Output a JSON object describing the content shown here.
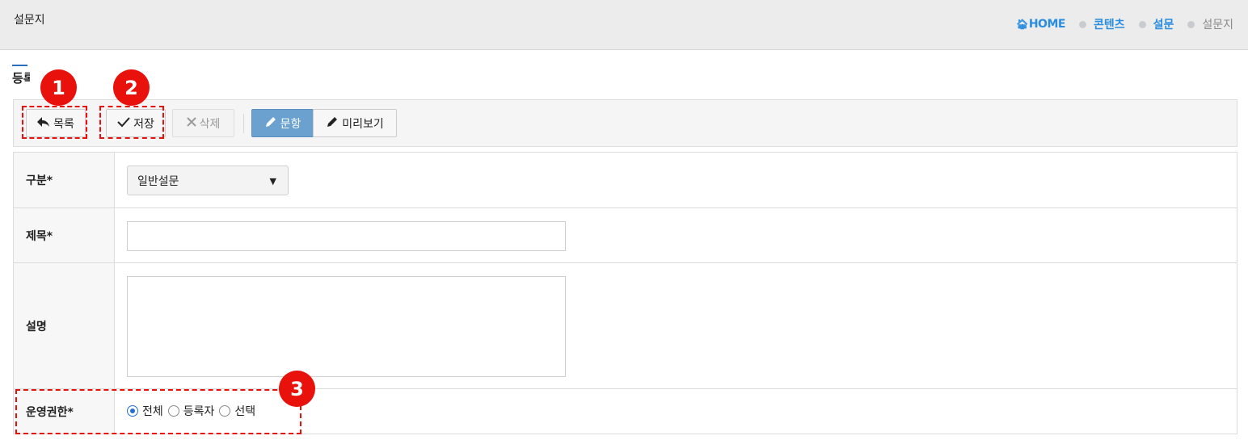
{
  "header": {
    "title": "설문지",
    "breadcrumb": {
      "home_icon": "home-icon",
      "home": "HOME",
      "items": [
        "콘텐츠",
        "설문",
        "설문지"
      ]
    }
  },
  "section": {
    "title": "등록"
  },
  "toolbar": {
    "list_label": "목록",
    "save_label": "저장",
    "delete_label": "삭제",
    "question_label": "문항",
    "preview_label": "미리보기",
    "icons": {
      "list": "reply-arrow-icon",
      "save": "checkmark-icon",
      "delete": "x-icon",
      "question": "pencil-icon",
      "preview": "pencil-icon"
    }
  },
  "form": {
    "category": {
      "label": "구분*",
      "value": "일반설문"
    },
    "title": {
      "label": "제목*",
      "value": ""
    },
    "description": {
      "label": "설명",
      "value": ""
    },
    "permission": {
      "label": "운영권한*",
      "options": [
        "전체",
        "등록자",
        "선택"
      ],
      "selected": "전체"
    }
  },
  "annotations": {
    "callouts": [
      "1",
      "2",
      "3"
    ],
    "color": "#e8110b"
  },
  "colors": {
    "accent": "#2a8de0",
    "primary_button": "#6aa1cf"
  }
}
